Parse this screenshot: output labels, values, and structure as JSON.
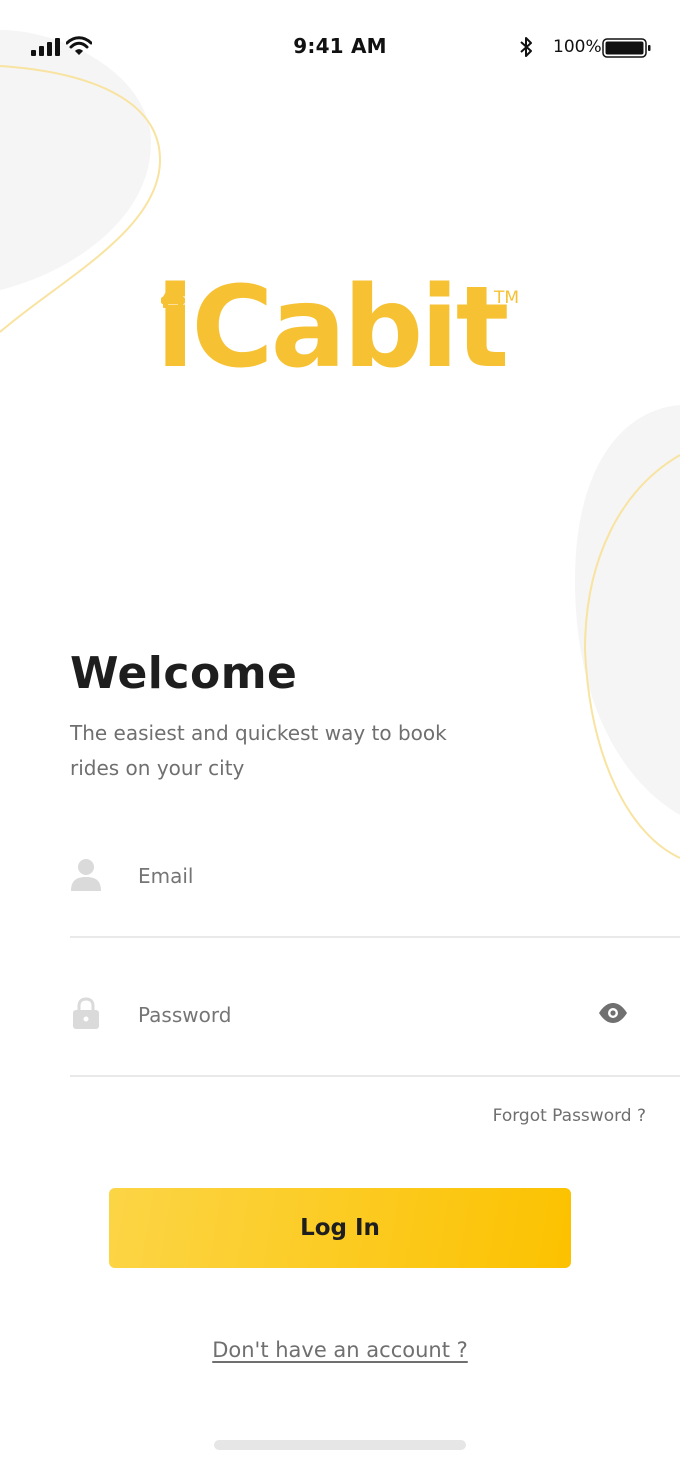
{
  "status_bar": {
    "time": "9:41 AM",
    "battery_percent": "100%",
    "battery_level": 1.0,
    "icons": [
      "signal-icon",
      "wifi-icon",
      "bluetooth-icon",
      "battery-icon"
    ]
  },
  "brand": {
    "logo_text": "iCabit",
    "trademark": "TM",
    "accent_color": "#f6c234",
    "logo_icon": "car-icon"
  },
  "welcome": {
    "title": "Welcome",
    "subtitle": "The easiest and quickest way to book rides on your city"
  },
  "form": {
    "email": {
      "placeholder": "Email",
      "value": "",
      "icon": "user-icon"
    },
    "password": {
      "placeholder": "Password",
      "value": "",
      "icon": "lock-icon",
      "toggle_icon": "eye-icon"
    },
    "forgot_password": "Forgot Password ?",
    "login_button": "Log In",
    "button_color": "#fcc200"
  },
  "signup": {
    "label": "Don't have an account ?"
  }
}
